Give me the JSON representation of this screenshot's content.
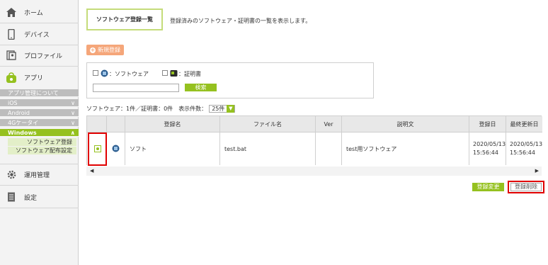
{
  "sidebar": {
    "home": "ホーム",
    "device": "デバイス",
    "profile": "プロファイル",
    "app": "アプリ",
    "app_sub": [
      "アプリ管理について",
      "iOS",
      "Android",
      "4Gケータイ",
      "Windows"
    ],
    "windows_sub": [
      "ソフトウェア登録",
      "ソフトウェア配布設定"
    ],
    "ops": "運用管理",
    "settings": "設定"
  },
  "header": {
    "title": "ソフトウェア登録一覧",
    "description": "登録済みのソフトウェア・証明書の一覧を表示します。"
  },
  "new_button": "新規登録",
  "filter": {
    "software_label": "：ソフトウェア",
    "cert_label": "：証明書",
    "search_value": "",
    "search_button": "検索"
  },
  "summary": {
    "counts": "ソフトウェア：1件／証明書：0件",
    "perpage_label": "表示件数：",
    "perpage_value": "25件"
  },
  "table": {
    "headers": [
      "登録名",
      "ファイル名",
      "Ver",
      "説明文",
      "登録日",
      "最終更新日"
    ],
    "rows": [
      {
        "name": "ソフト",
        "file": "test.bat",
        "ver": "",
        "desc": "test用ソフトウェア",
        "reg_date": "2020/05/13 15:56:44",
        "upd_date": "2020/05/13 15:56:44"
      }
    ]
  },
  "actions": {
    "change": "登録変更",
    "delete": "登録削除"
  },
  "colors": {
    "accent": "#95c11f",
    "orange": "#f5a67a",
    "highlight": "#e00000"
  }
}
